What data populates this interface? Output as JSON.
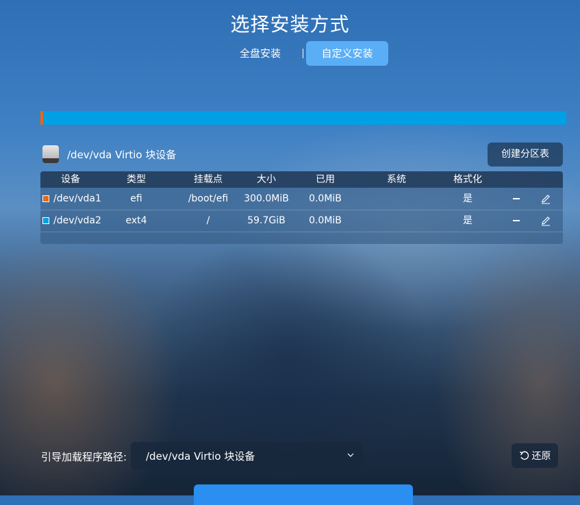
{
  "title": "选择安装方式",
  "tabs": [
    {
      "label": "全盘安装",
      "active": false
    },
    {
      "label": "自定义安装",
      "active": true
    }
  ],
  "usage_bar": {
    "segments": [
      {
        "color": "#e0691c",
        "fraction": 0.005
      },
      {
        "color": "#00a0e4",
        "fraction": 0.995
      }
    ]
  },
  "disk": {
    "label": "/dev/vda Virtio 块设备",
    "icon": "hard-disk-icon"
  },
  "create_table_button": "创建分区表",
  "table": {
    "headers": [
      "设备",
      "类型",
      "挂载点",
      "大小",
      "已用",
      "系统",
      "格式化"
    ],
    "rows": [
      {
        "color": "#e0691c",
        "device": "/dev/vda1",
        "type": "efi",
        "mount": "/boot/efi",
        "size": "300.0MiB",
        "used": "0.0MiB",
        "system": "",
        "format": "是"
      },
      {
        "color": "#00a0e4",
        "device": "/dev/vda2",
        "type": "ext4",
        "mount": "/",
        "size": "59.7GiB",
        "used": "0.0MiB",
        "system": "",
        "format": "是"
      }
    ]
  },
  "bootloader": {
    "label": "引导加载程序路径:",
    "value": "/dev/vda Virtio 块设备"
  },
  "restore_button": "还原",
  "colors": {
    "accent": "#5aaef5",
    "primary_button": "#2a8ff0"
  }
}
